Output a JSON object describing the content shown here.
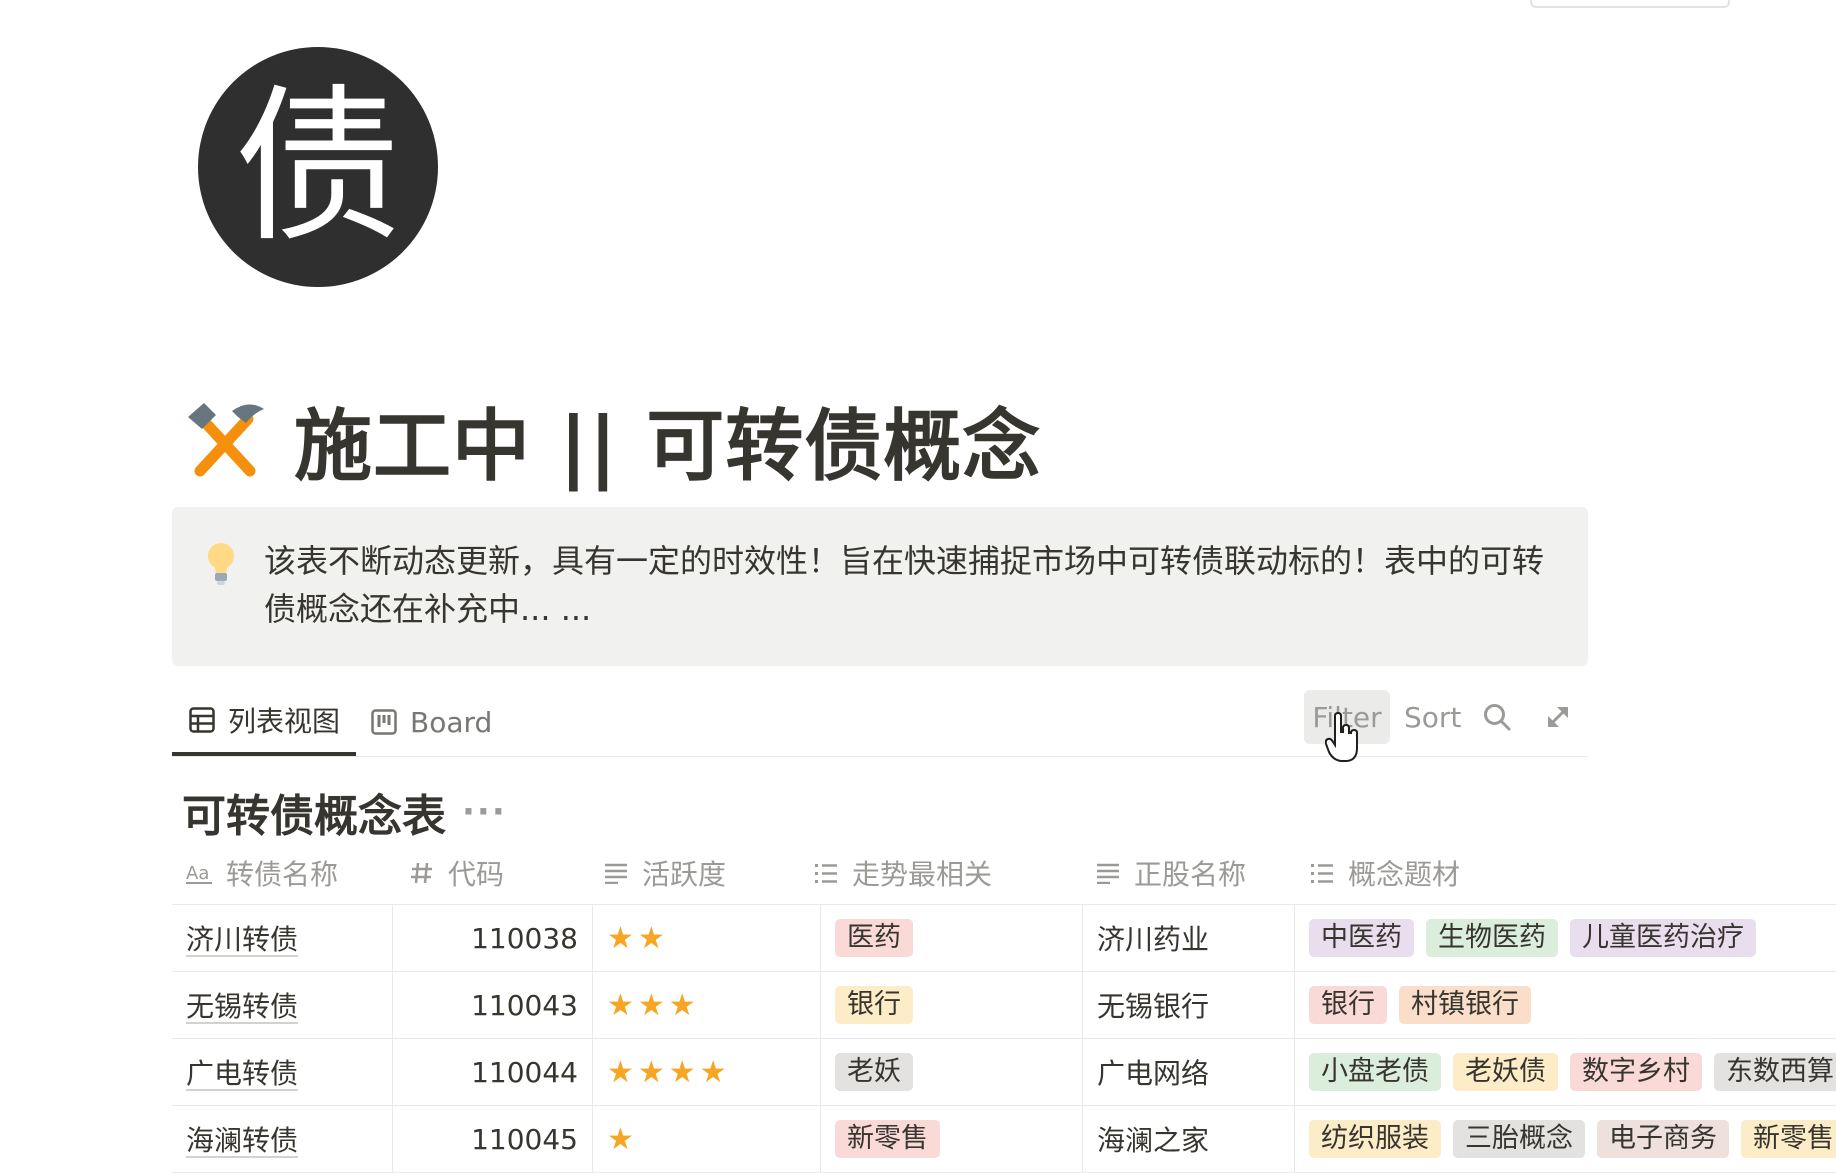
{
  "page": {
    "icon_char": "债",
    "title": "施工中 || 可转债概念",
    "callout_text": "该表不断动态更新，具有一定的时效性！旨在快速捕捉市场中可转债联动标的！表中的可转债概念还在补充中... ..."
  },
  "tabs": [
    {
      "label": "列表视图",
      "active": true
    },
    {
      "label": "Board",
      "active": false
    }
  ],
  "toolbar": {
    "filter": "Filter",
    "sort": "Sort"
  },
  "database": {
    "title": "可转债概念表",
    "columns": [
      {
        "label": "转债名称",
        "icon": "title-aa-icon"
      },
      {
        "label": "代码",
        "icon": "number-hash-icon"
      },
      {
        "label": "活跃度",
        "icon": "text-lines-icon"
      },
      {
        "label": "走势最相关",
        "icon": "list-icon"
      },
      {
        "label": "正股名称",
        "icon": "text-lines-icon"
      },
      {
        "label": "概念题材",
        "icon": "list-icon"
      }
    ],
    "rows": [
      {
        "name": "济川转债",
        "code": "110038",
        "stars": "★★",
        "related": {
          "label": "医药",
          "color": "#fadad7"
        },
        "stock": "济川药业",
        "tags": [
          {
            "label": "中医药",
            "color": "#e8deee"
          },
          {
            "label": "生物医药",
            "color": "#dbeddb"
          },
          {
            "label": "儿童医药治疗",
            "color": "#e8deee"
          }
        ]
      },
      {
        "name": "无锡转债",
        "code": "110043",
        "stars": "★★★",
        "related": {
          "label": "银行",
          "color": "#fdecc8"
        },
        "stock": "无锡银行",
        "tags": [
          {
            "label": "银行",
            "color": "#fadad7"
          },
          {
            "label": "村镇银行",
            "color": "#fadec9"
          }
        ]
      },
      {
        "name": "广电转债",
        "code": "110044",
        "stars": "★★★★",
        "related": {
          "label": "老妖",
          "color": "#e3e2e0"
        },
        "stock": "广电网络",
        "tags": [
          {
            "label": "小盘老债",
            "color": "#dbeddb"
          },
          {
            "label": "老妖债",
            "color": "#fdecc8"
          },
          {
            "label": "数字乡村",
            "color": "#fadad7"
          },
          {
            "label": "东数西算",
            "color": "#e3e2e0"
          }
        ]
      },
      {
        "name": "海澜转债",
        "code": "110045",
        "stars": "★",
        "related": {
          "label": "新零售",
          "color": "#fadad7"
        },
        "stock": "海澜之家",
        "tags": [
          {
            "label": "纺织服装",
            "color": "#fdecc8"
          },
          {
            "label": "三胎概念",
            "color": "#e3e2e0"
          },
          {
            "label": "电子商务",
            "color": "#eee0da"
          },
          {
            "label": "新零售",
            "color": "#fdecc8"
          }
        ]
      }
    ]
  }
}
